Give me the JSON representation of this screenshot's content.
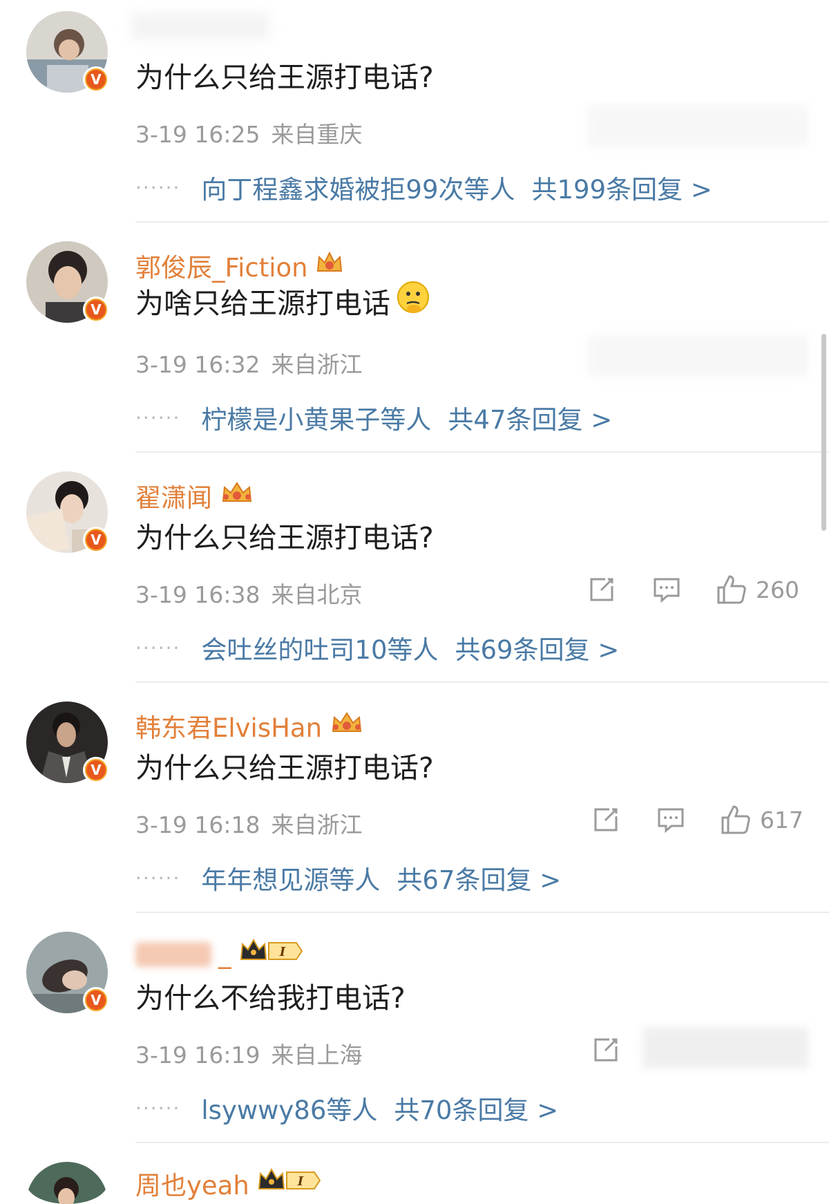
{
  "comments": [
    {
      "username": "",
      "text": "为什么只给王源打电话?",
      "time": "3-19 16:25",
      "location": "来自重庆",
      "reply_names": "向丁程鑫求婚被拒99次等人",
      "reply_total": "共199条回复 >",
      "likes": ""
    },
    {
      "username": "郭俊辰_Fiction",
      "text": "为啥只给王源打电话",
      "emoji": "🤔",
      "time": "3-19 16:32",
      "location": "来自浙江",
      "reply_names": "柠檬是小黄果子等人",
      "reply_total": "共47条回复 >",
      "likes": ""
    },
    {
      "username": "翟潇闻",
      "text": "为什么只给王源打电话?",
      "time": "3-19 16:38",
      "location": "来自北京",
      "reply_names": "会吐丝的吐司10等人",
      "reply_total": "共69条回复 >",
      "likes": "260"
    },
    {
      "username": "韩东君ElvisHan",
      "text": "为什么只给王源打电话?",
      "time": "3-19 16:18",
      "location": "来自浙江",
      "reply_names": "年年想见源等人",
      "reply_total": "共67条回复 >",
      "likes": "617"
    },
    {
      "username": "",
      "text": "为什么不给我打电话?",
      "time": "3-19 16:19",
      "location": "来自上海",
      "reply_names": "lsywwy86等人",
      "reply_total": "共70条回复 >",
      "likes": ""
    },
    {
      "username": "周也yeah",
      "text": "",
      "time": "",
      "location": "",
      "reply_names": "",
      "reply_total": "",
      "likes": ""
    }
  ],
  "dots": "······",
  "verified_badge": "V",
  "rank_badge": "I",
  "colors": {
    "username": "#e2803a",
    "reply_link": "#4a7aa5",
    "meta": "#9a9a9a",
    "badge": "#e8581c"
  },
  "icons": [
    "forward-icon",
    "comment-icon",
    "thumbs-up-icon",
    "crown-icon",
    "verified-icon"
  ]
}
